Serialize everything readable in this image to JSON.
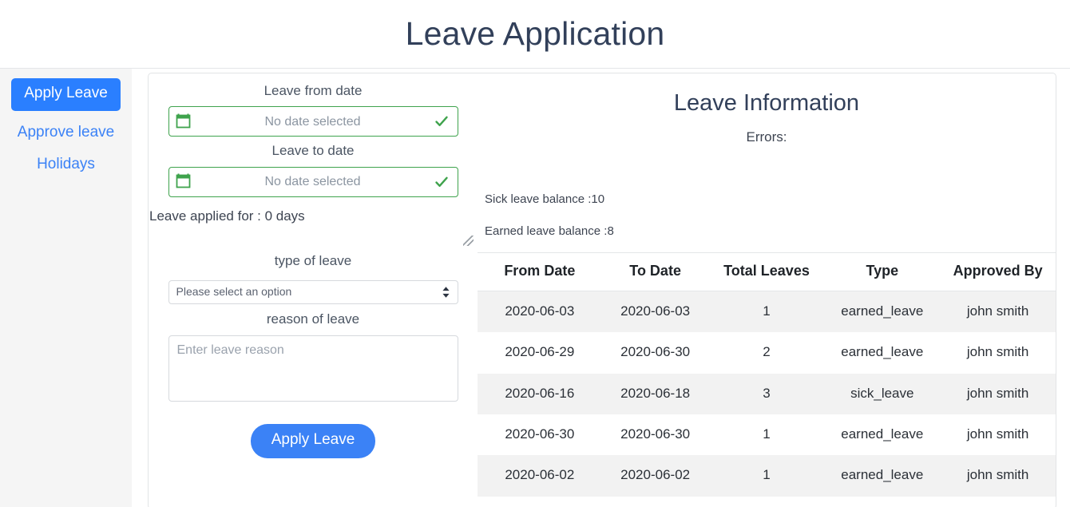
{
  "header": {
    "title": "Leave Application"
  },
  "sidebar": {
    "items": [
      {
        "label": "Apply Leave",
        "active": true
      },
      {
        "label": "Approve leave",
        "active": false
      },
      {
        "label": "Holidays",
        "active": false
      }
    ]
  },
  "form": {
    "from_label": "Leave from date",
    "from_value": "No date selected",
    "to_label": "Leave to date",
    "to_value": "No date selected",
    "applied_days_text": "Leave applied for : 0 days",
    "type_label": "type of leave",
    "type_selected": "Please select an option",
    "type_options": [
      "Please select an option"
    ],
    "reason_label": "reason of leave",
    "reason_value": "",
    "reason_placeholder": "Enter leave reason",
    "submit_label": "Apply Leave"
  },
  "info": {
    "title": "Leave Information",
    "errors_label": "Errors:",
    "errors_value": "",
    "sick_balance_text": "Sick leave balance :10",
    "earned_balance_text": "Earned leave balance :8"
  },
  "table": {
    "headers": [
      "From Date",
      "To Date",
      "Total Leaves",
      "Type",
      "Approved By"
    ],
    "rows": [
      {
        "from": "2020-06-03",
        "to": "2020-06-03",
        "total": "1",
        "type": "earned_leave",
        "approved_by": "john smith"
      },
      {
        "from": "2020-06-29",
        "to": "2020-06-30",
        "total": "2",
        "type": "earned_leave",
        "approved_by": "john smith"
      },
      {
        "from": "2020-06-16",
        "to": "2020-06-18",
        "total": "3",
        "type": "sick_leave",
        "approved_by": "john smith"
      },
      {
        "from": "2020-06-30",
        "to": "2020-06-30",
        "total": "1",
        "type": "earned_leave",
        "approved_by": "john smith"
      },
      {
        "from": "2020-06-02",
        "to": "2020-06-02",
        "total": "1",
        "type": "earned_leave",
        "approved_by": "john smith"
      }
    ]
  },
  "colors": {
    "primary": "#3b82f6",
    "active_nav": "#2a7fff",
    "valid_green": "#3fa34d",
    "title": "#32405a",
    "stripe": "#f2f2f2",
    "sidebar_bg": "#f5f5f5"
  }
}
